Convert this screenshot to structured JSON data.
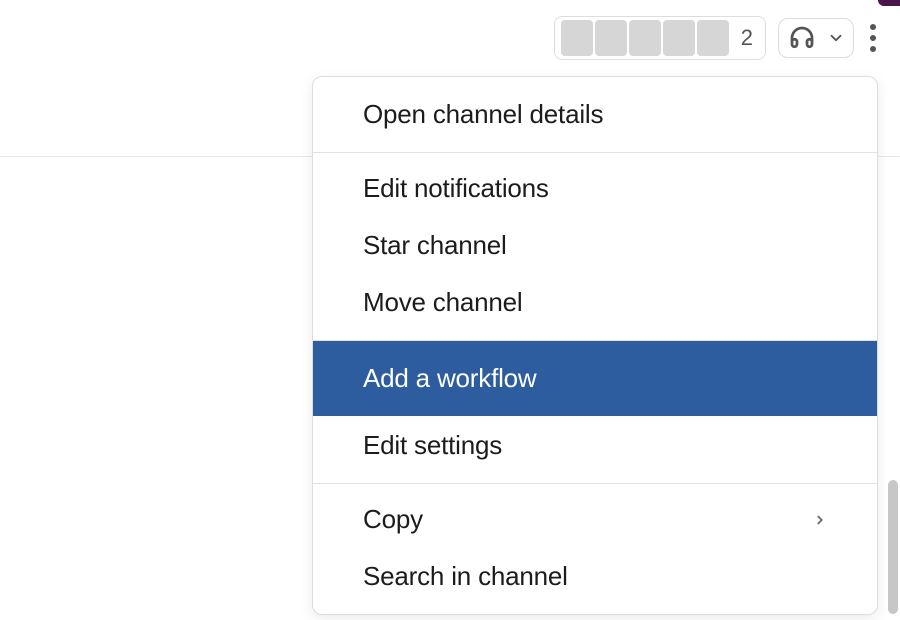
{
  "header": {
    "member_count": "2"
  },
  "menu": {
    "open_details": "Open channel details",
    "edit_notifications": "Edit notifications",
    "star_channel": "Star channel",
    "move_channel": "Move channel",
    "add_workflow": "Add a workflow",
    "edit_settings": "Edit settings",
    "copy": "Copy",
    "search_in_channel": "Search in channel"
  },
  "colors": {
    "highlight": "#2d5d9f"
  }
}
